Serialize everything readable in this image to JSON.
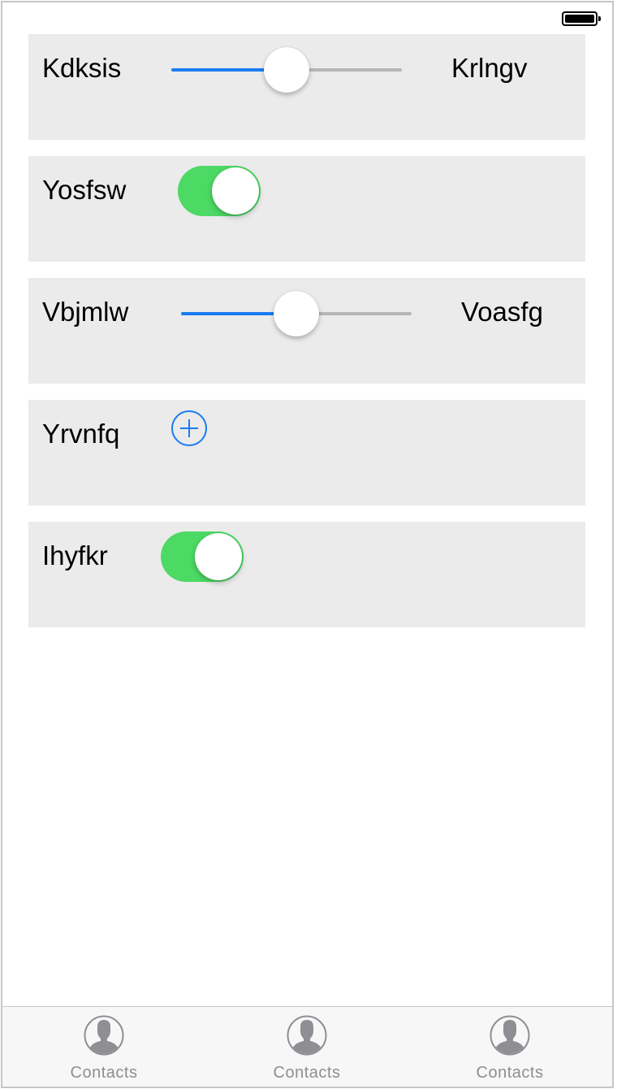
{
  "status_bar": {
    "battery_icon": "battery-full-icon"
  },
  "rows": [
    {
      "type": "slider",
      "label": "Kdksis",
      "right_label": "Krlngv",
      "value_fraction": 0.5
    },
    {
      "type": "toggle",
      "label": "Yosfsw",
      "on": true
    },
    {
      "type": "slider",
      "label": "Vbjmlw",
      "right_label": "Voasfg",
      "value_fraction": 0.5
    },
    {
      "type": "add-button",
      "label": "Yrvnfq",
      "icon": "plus-circle-icon"
    },
    {
      "type": "toggle",
      "label": "Ihyfkr",
      "on": true
    }
  ],
  "tabbar": {
    "items": [
      {
        "label": "Contacts",
        "icon": "contact-icon"
      },
      {
        "label": "Contacts",
        "icon": "contact-icon"
      },
      {
        "label": "Contacts",
        "icon": "contact-icon"
      }
    ]
  },
  "colors": {
    "accent": "#1a7cf3",
    "toggle_on": "#4cd964",
    "row_bg": "#ebebeb",
    "tab_gray": "#8e8e93"
  }
}
